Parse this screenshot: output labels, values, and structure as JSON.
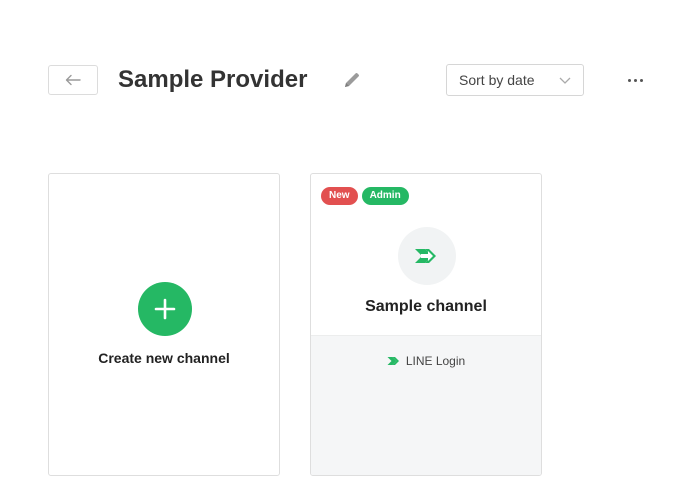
{
  "header": {
    "title": "Sample Provider",
    "sort": {
      "selected": "Sort by date"
    }
  },
  "create_card": {
    "label": "Create new channel"
  },
  "channels": [
    {
      "name": "Sample channel",
      "badges": [
        "New",
        "Admin"
      ],
      "type_label": "LINE Login"
    }
  ],
  "colors": {
    "accent_green": "#25b864",
    "badge_red": "#e25050",
    "footer_gray": "#f5f6f7"
  },
  "icons": {
    "back": "arrow-left-icon",
    "edit": "pencil-icon",
    "sort": "chevron-down-icon",
    "more": "more-horizontal-icon",
    "create": "plus-icon",
    "channel": "line-login-arrow-icon"
  }
}
